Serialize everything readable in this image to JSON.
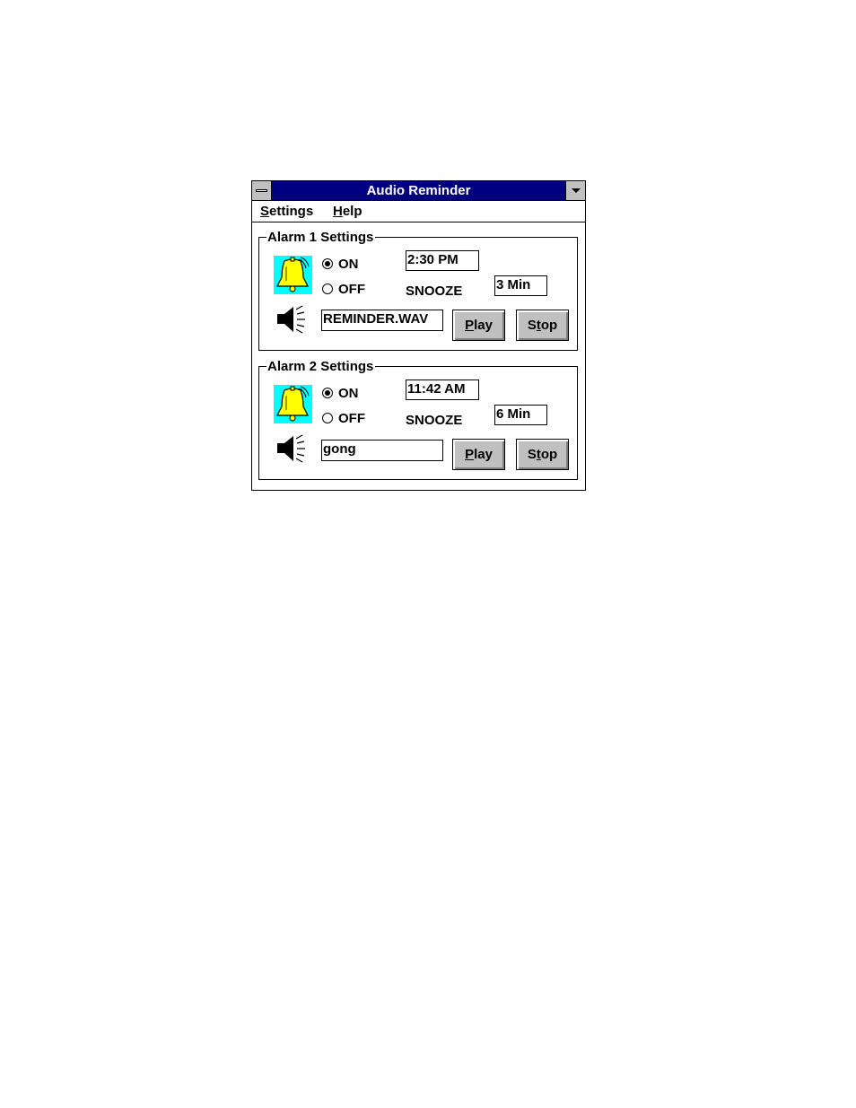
{
  "window": {
    "title": "Audio Reminder"
  },
  "menu": {
    "settings": {
      "first": "S",
      "rest": "ettings"
    },
    "help": {
      "first": "H",
      "rest": "elp"
    }
  },
  "alarms": [
    {
      "legend": "Alarm 1 Settings",
      "on_label": "ON",
      "off_label": "OFF",
      "selected": "ON",
      "time": "2:30 PM",
      "snooze_label": "SNOOZE",
      "snooze": "3 Min",
      "sound_file": "REMINDER.WAV",
      "play": {
        "pre": "",
        "u": "P",
        "post": "lay"
      },
      "stop": {
        "pre": "S",
        "u": "t",
        "post": "op"
      }
    },
    {
      "legend": "Alarm 2 Settings",
      "on_label": "ON",
      "off_label": "OFF",
      "selected": "ON",
      "time": "11:42 AM",
      "snooze_label": "SNOOZE",
      "snooze": "6 Min",
      "sound_file": "gong",
      "play": {
        "pre": "",
        "u": "P",
        "post": "lay"
      },
      "stop": {
        "pre": "S",
        "u": "t",
        "post": "op"
      }
    }
  ],
  "colors": {
    "titlebar": "#000080",
    "icon_bg": "#00ffff",
    "bell": "#ffff00",
    "button": "#c0c0c0"
  },
  "icons": {
    "bell": "bell-icon",
    "speaker": "speaker-icon"
  }
}
